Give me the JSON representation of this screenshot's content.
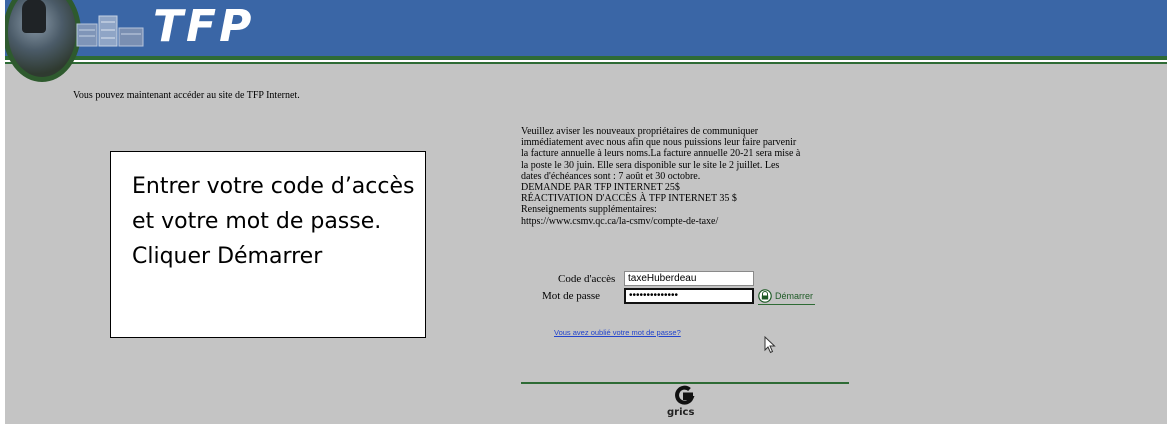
{
  "header": {
    "logo_text": "TFP",
    "accent_blue": "#3a66a6",
    "accent_green": "#2e6b35"
  },
  "welcome_text": "Vous pouvez maintenant accéder au site de TFP Internet.",
  "callout": {
    "text": "Entrer votre code d’accès et votre mot de passe. Cliquer Démarrer"
  },
  "notice": {
    "lines": [
      "Veuillez aviser les nouveaux propriétaires de communiquer",
      "immédiatement avec nous afin que nous puissions leur faire parvenir",
      "la facture annuelle à leurs noms.La facture annuelle 20-21 sera mise à",
      "la poste le 30 juin. Elle sera disponible sur le site le 2 juillet. Les",
      "dates d'échéances sont : 7 août et 30 octobre.",
      "DEMANDE PAR TFP INTERNET 25$",
      "RÉACTIVATION D'ACCÈS À TFP INTERNET 35 $",
      "Renseignements supplémentaires:",
      "https://www.csmv.qc.ca/la-csmv/compte-de-taxe/"
    ]
  },
  "login": {
    "code_label": "Code d'accès",
    "code_value": "taxeHuberdeau",
    "password_label": "Mot de passe",
    "password_value": "••••••••••••••",
    "start_label": "Démarrer",
    "start_icon": "lock-icon"
  },
  "forgot_link": "Vous avez oublié votre mot de passe?",
  "footer": {
    "brand": "grics",
    "brand_icon": "grics-logo-icon"
  }
}
